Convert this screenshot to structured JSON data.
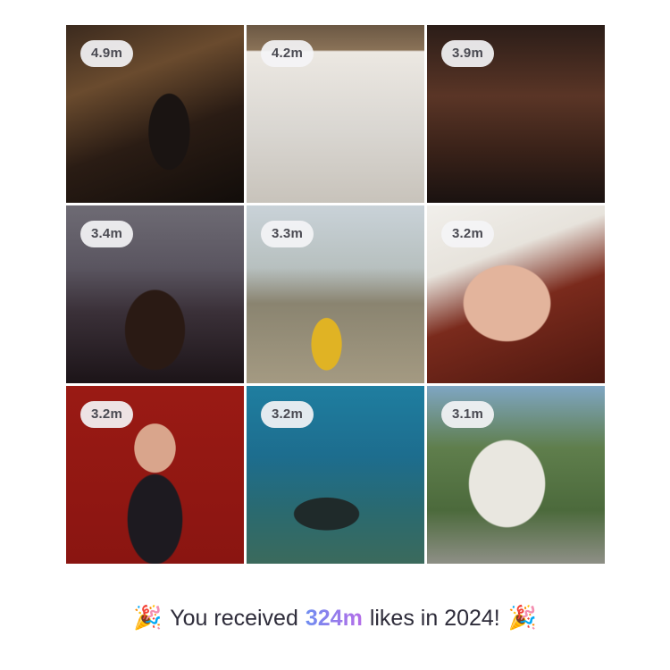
{
  "tiles": [
    {
      "likes": "4.9m"
    },
    {
      "likes": "4.2m"
    },
    {
      "likes": "3.9m"
    },
    {
      "likes": "3.4m"
    },
    {
      "likes": "3.3m"
    },
    {
      "likes": "3.2m"
    },
    {
      "likes": "3.2m"
    },
    {
      "likes": "3.2m"
    },
    {
      "likes": "3.1m"
    }
  ],
  "footer": {
    "emoji_left": "🎉",
    "text_before": "You received",
    "highlight": "324m",
    "text_after": "likes in 2024!",
    "emoji_right": "🎉",
    "emoji_name": "party-popper-icon"
  },
  "colors": {
    "highlight_gradient": [
      "#6f8df0",
      "#b56de8"
    ],
    "text": "#2e2c3a",
    "badge_bg": "#f4f4f6"
  }
}
